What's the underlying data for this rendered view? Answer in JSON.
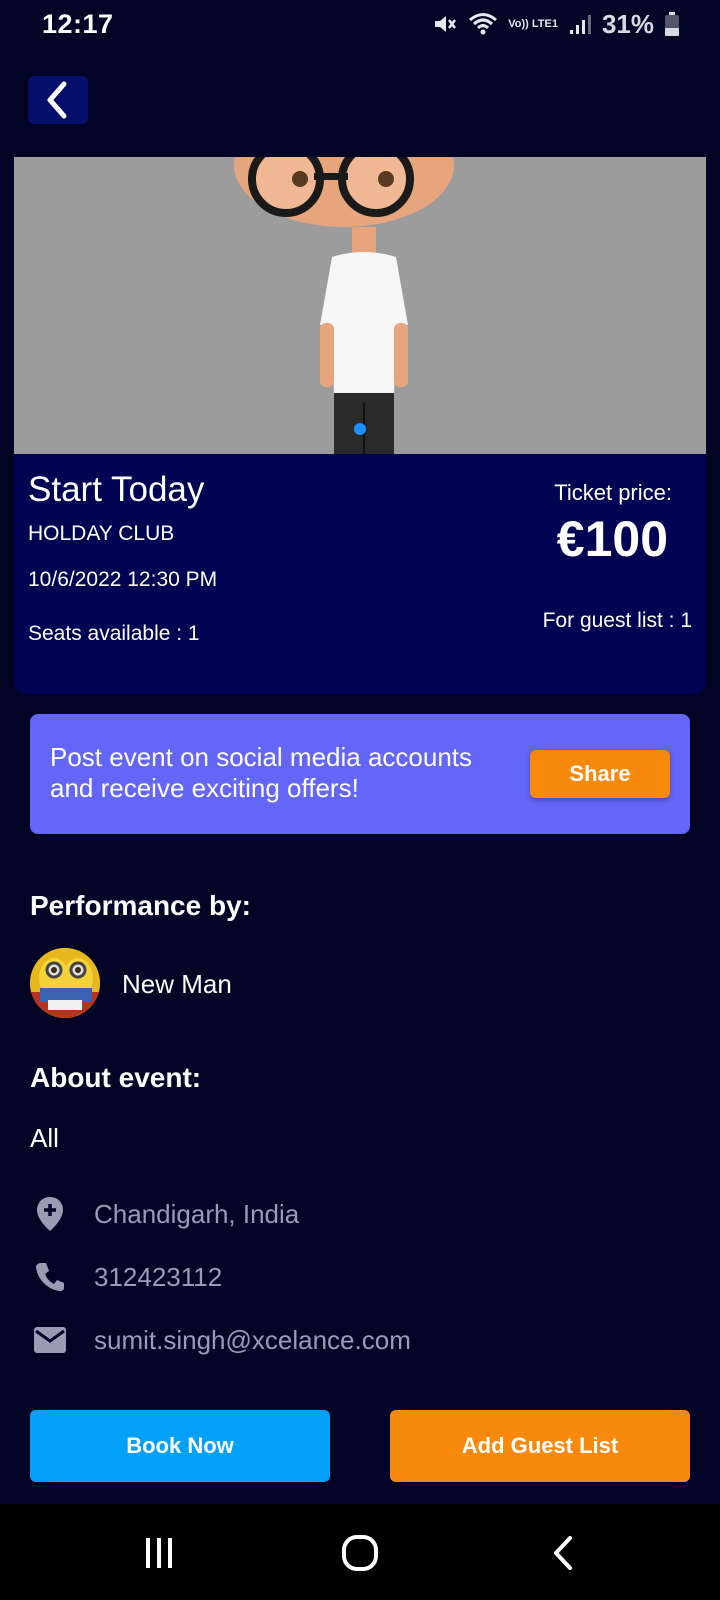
{
  "status_bar": {
    "time": "12:17",
    "battery": "31%",
    "icons": [
      "mute-icon",
      "wifi-icon",
      "volte-icon",
      "signal-icon",
      "battery-icon"
    ],
    "volte_label": "Vo)) LTE1"
  },
  "header": {
    "back_icon": "chevron-left-icon"
  },
  "hero": {
    "carousel_active_index": 0,
    "dot_color": "#1e90ff"
  },
  "event": {
    "title": "Start Today",
    "venue": "HOLDAY CLUB",
    "datetime": "10/6/2022 12:30 PM",
    "seats": "Seats available : 1",
    "price_label": "Ticket price:",
    "price": "€100",
    "guest_list": "For guest list : 1"
  },
  "share": {
    "text": "Post event on social media accounts and receive exciting offers!",
    "button_label": "Share"
  },
  "performance": {
    "title": "Performance by:",
    "performer_name": "New Man"
  },
  "about": {
    "title": "About event:",
    "text": "All"
  },
  "contact": {
    "location": "Chandigarh, India",
    "phone": "312423112",
    "email": "sumit.singh@xcelance.com"
  },
  "actions": {
    "book_label": "Book Now",
    "guest_label": "Add Guest List"
  },
  "colors": {
    "background": "#020426",
    "card": "#000352",
    "banner": "#6366f6",
    "primary_button": "#03a0fa",
    "accent_button": "#f7890c"
  },
  "nav": {
    "icons": [
      "recent-apps-icon",
      "home-icon",
      "back-icon"
    ]
  }
}
